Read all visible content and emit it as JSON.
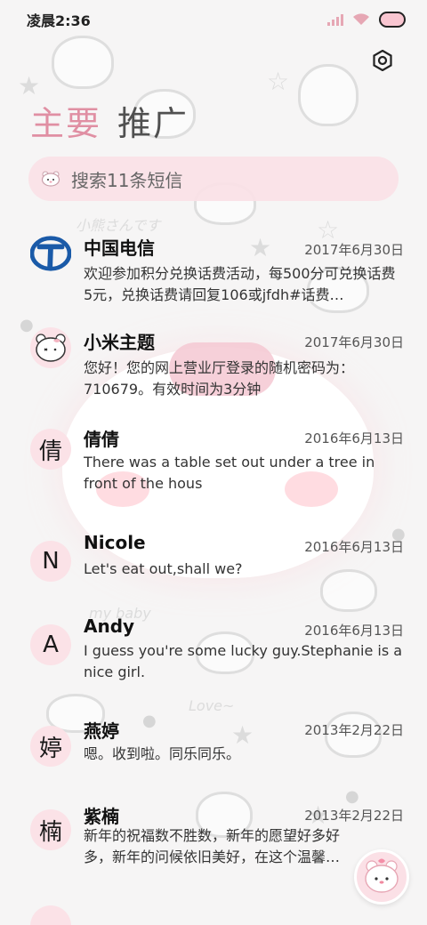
{
  "status_bar": {
    "time": "凌晨2:36"
  },
  "header": {
    "tabs": [
      {
        "label": "主要",
        "active": true
      },
      {
        "label": "推广",
        "active": false
      }
    ],
    "settings_icon": "settings-icon"
  },
  "search": {
    "placeholder": "搜索11条短信"
  },
  "messages": [
    {
      "sender": "中国电信",
      "date": "2017年6月30日",
      "preview": "欢迎参加积分兑换话费活动，每500分可兑换话费5元，兑换话费请回复106或jfdh#话费…",
      "avatar_type": "logo"
    },
    {
      "sender": "小米主题",
      "date": "2017年6月30日",
      "preview": "您好！您的网上营业厅登录的随机密码为：710679。有效时间为3分钟",
      "avatar_type": "image"
    },
    {
      "sender": "倩倩",
      "date": "2016年6月13日",
      "preview": "There was a table set out under a tree in front of the hous",
      "avatar_letter": "倩"
    },
    {
      "sender": "Nicole",
      "date": "2016年6月13日",
      "preview": "Let's eat out,shall we?",
      "avatar_letter": "N"
    },
    {
      "sender": "Andy",
      "date": "2016年6月13日",
      "preview": "I guess you're some lucky guy.Stephanie is a nice girl.",
      "avatar_letter": "A"
    },
    {
      "sender": "燕婷",
      "date": "2013年2月22日",
      "preview": "嗯。收到啦。同乐同乐。",
      "avatar_letter": "婷"
    },
    {
      "sender": "紫楠",
      "date": "2013年2月22日",
      "preview": "新年的祝福数不胜数，新年的愿望好多好多，新年的问候依旧美好，在这个温馨的时",
      "avatar_letter": "楠"
    }
  ],
  "colors": {
    "accent": "#e08fa3",
    "avatar_bg": "#fbe2e7",
    "search_bg": "#fae1e6",
    "telecom_blue": "#1a5aa8"
  }
}
